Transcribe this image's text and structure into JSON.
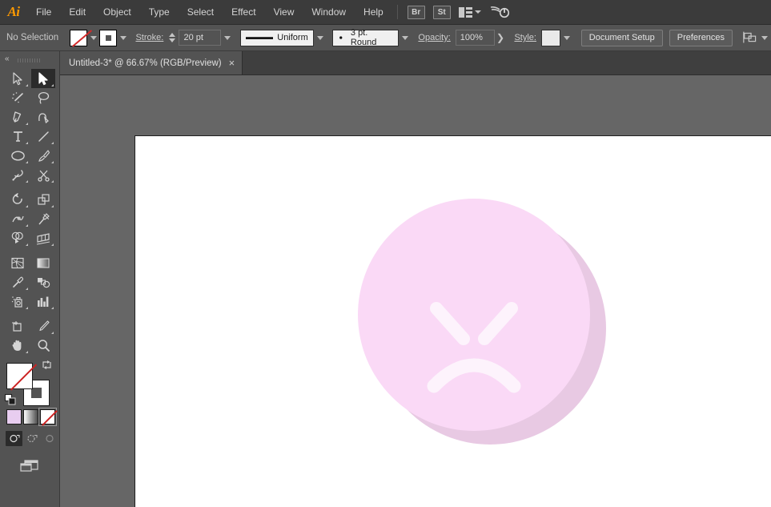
{
  "app": {
    "name": "Adobe Illustrator",
    "logo_text": "Ai",
    "accent_color": "#ff9a00"
  },
  "menubar": {
    "items": [
      {
        "label": "File"
      },
      {
        "label": "Edit"
      },
      {
        "label": "Object"
      },
      {
        "label": "Type"
      },
      {
        "label": "Select"
      },
      {
        "label": "Effect"
      },
      {
        "label": "View"
      },
      {
        "label": "Window"
      },
      {
        "label": "Help"
      }
    ],
    "right_buttons": [
      {
        "label": "Br",
        "name": "bridge-button"
      },
      {
        "label": "St",
        "name": "stock-button"
      }
    ],
    "arrange_documents": {
      "icon": "arrange-documents-icon"
    },
    "workspace_switcher": {
      "icon": "workspace-icon"
    }
  },
  "controlbar": {
    "selection_status": "No Selection",
    "fill_swatch": {
      "value": "None",
      "icon": "fill-none-swatch"
    },
    "stroke_swatch": {
      "value": "White",
      "icon": "stroke-swatch"
    },
    "stroke_label": "Stroke:",
    "stroke_weight": "20 pt",
    "profile_label": "Uniform",
    "brush_label": "3 pt. Round",
    "opacity_label": "Opacity:",
    "opacity_value": "100%",
    "style_label": "Style:",
    "document_setup_label": "Document Setup",
    "preferences_label": "Preferences",
    "align_icon": "align-icon"
  },
  "tabs": [
    {
      "title": "Untitled-3* @ 66.67% (RGB/Preview)",
      "document_name": "Untitled-3*",
      "zoom": "66.67%",
      "color_mode": "RGB/Preview",
      "close_label": "×",
      "active": true
    }
  ],
  "toolbar": {
    "collapse_label": "«",
    "tools": [
      {
        "name": "selection-tool",
        "label": "Selection Tool",
        "active": false,
        "has_flyout": true
      },
      {
        "name": "direct-selection-tool",
        "label": "Direct Selection Tool",
        "active": true,
        "has_flyout": true
      },
      {
        "name": "magic-wand-tool",
        "label": "Magic Wand Tool",
        "active": false,
        "has_flyout": false
      },
      {
        "name": "lasso-tool",
        "label": "Lasso Tool",
        "active": false,
        "has_flyout": false
      },
      {
        "name": "pen-tool",
        "label": "Pen Tool",
        "active": false,
        "has_flyout": true
      },
      {
        "name": "curvature-tool",
        "label": "Curvature Tool",
        "active": false,
        "has_flyout": false
      },
      {
        "name": "type-tool",
        "label": "Type Tool",
        "active": false,
        "has_flyout": true
      },
      {
        "name": "line-segment-tool",
        "label": "Line Segment Tool",
        "active": false,
        "has_flyout": true
      },
      {
        "name": "ellipse-tool",
        "label": "Ellipse Tool",
        "active": false,
        "has_flyout": true
      },
      {
        "name": "paintbrush-tool",
        "label": "Paintbrush Tool",
        "active": false,
        "has_flyout": true
      },
      {
        "name": "shaper-tool",
        "label": "Shaper Tool",
        "active": false,
        "has_flyout": true
      },
      {
        "name": "scissors-tool",
        "label": "Scissors Tool",
        "active": false,
        "has_flyout": true
      },
      {
        "name": "rotate-tool",
        "label": "Rotate Tool",
        "active": false,
        "has_flyout": true
      },
      {
        "name": "scale-tool",
        "label": "Scale Tool",
        "active": false,
        "has_flyout": true
      },
      {
        "name": "width-tool",
        "label": "Width Tool",
        "active": false,
        "has_flyout": true
      },
      {
        "name": "free-transform-tool",
        "label": "Free Transform Tool",
        "active": false,
        "has_flyout": false
      },
      {
        "name": "shape-builder-tool",
        "label": "Shape Builder Tool",
        "active": false,
        "has_flyout": true
      },
      {
        "name": "perspective-grid-tool",
        "label": "Perspective Grid Tool",
        "active": false,
        "has_flyout": true
      },
      {
        "name": "mesh-tool",
        "label": "Mesh Tool",
        "active": false,
        "has_flyout": false
      },
      {
        "name": "gradient-tool",
        "label": "Gradient Tool",
        "active": false,
        "has_flyout": false
      },
      {
        "name": "eyedropper-tool",
        "label": "Eyedropper Tool",
        "active": false,
        "has_flyout": true
      },
      {
        "name": "blend-tool",
        "label": "Blend Tool",
        "active": false,
        "has_flyout": false
      },
      {
        "name": "symbol-sprayer-tool",
        "label": "Symbol Sprayer Tool",
        "active": false,
        "has_flyout": true
      },
      {
        "name": "column-graph-tool",
        "label": "Column Graph Tool",
        "active": false,
        "has_flyout": true
      },
      {
        "name": "artboard-tool",
        "label": "Artboard Tool",
        "active": false,
        "has_flyout": false
      },
      {
        "name": "slice-tool",
        "label": "Slice Tool",
        "active": false,
        "has_flyout": true
      },
      {
        "name": "hand-tool",
        "label": "Hand Tool",
        "active": false,
        "has_flyout": true
      },
      {
        "name": "zoom-tool",
        "label": "Zoom Tool",
        "active": false,
        "has_flyout": false
      }
    ],
    "fill_stroke": {
      "fill": "None",
      "fill_color": "#ffffff",
      "stroke": "White",
      "stroke_color": "#ffffff",
      "swap_label": "Swap Fill and Stroke",
      "default_label": "Default Fill and Stroke"
    },
    "mini_swatches": [
      {
        "name": "color-swatch-button",
        "label": "Color",
        "color": "#e8cdf0",
        "selected": false
      },
      {
        "name": "gradient-swatch-button",
        "label": "Gradient",
        "color": "gradient",
        "selected": false
      },
      {
        "name": "none-swatch-button",
        "label": "None",
        "color": "none",
        "selected": true
      }
    ],
    "draw_modes": [
      {
        "name": "draw-normal-button",
        "label": "Draw Normal",
        "active": true
      },
      {
        "name": "draw-behind-button",
        "label": "Draw Behind",
        "active": false
      },
      {
        "name": "draw-inside-button",
        "label": "Draw Inside",
        "active": false
      }
    ],
    "screen_mode": {
      "name": "change-screen-mode-button",
      "label": "Change Screen Mode"
    }
  },
  "canvas": {
    "background_color": "#666666",
    "artboard_color": "#ffffff",
    "artwork": {
      "name": "angry-face-emoji",
      "description": "Angry face emoji illustration",
      "face_color": "#fad9f6",
      "shadow_color": "#e8c9e3",
      "feature_color": "#fdf2fb",
      "features": [
        "left-angry-eye",
        "right-angry-eye",
        "frowning-mouth"
      ]
    }
  }
}
